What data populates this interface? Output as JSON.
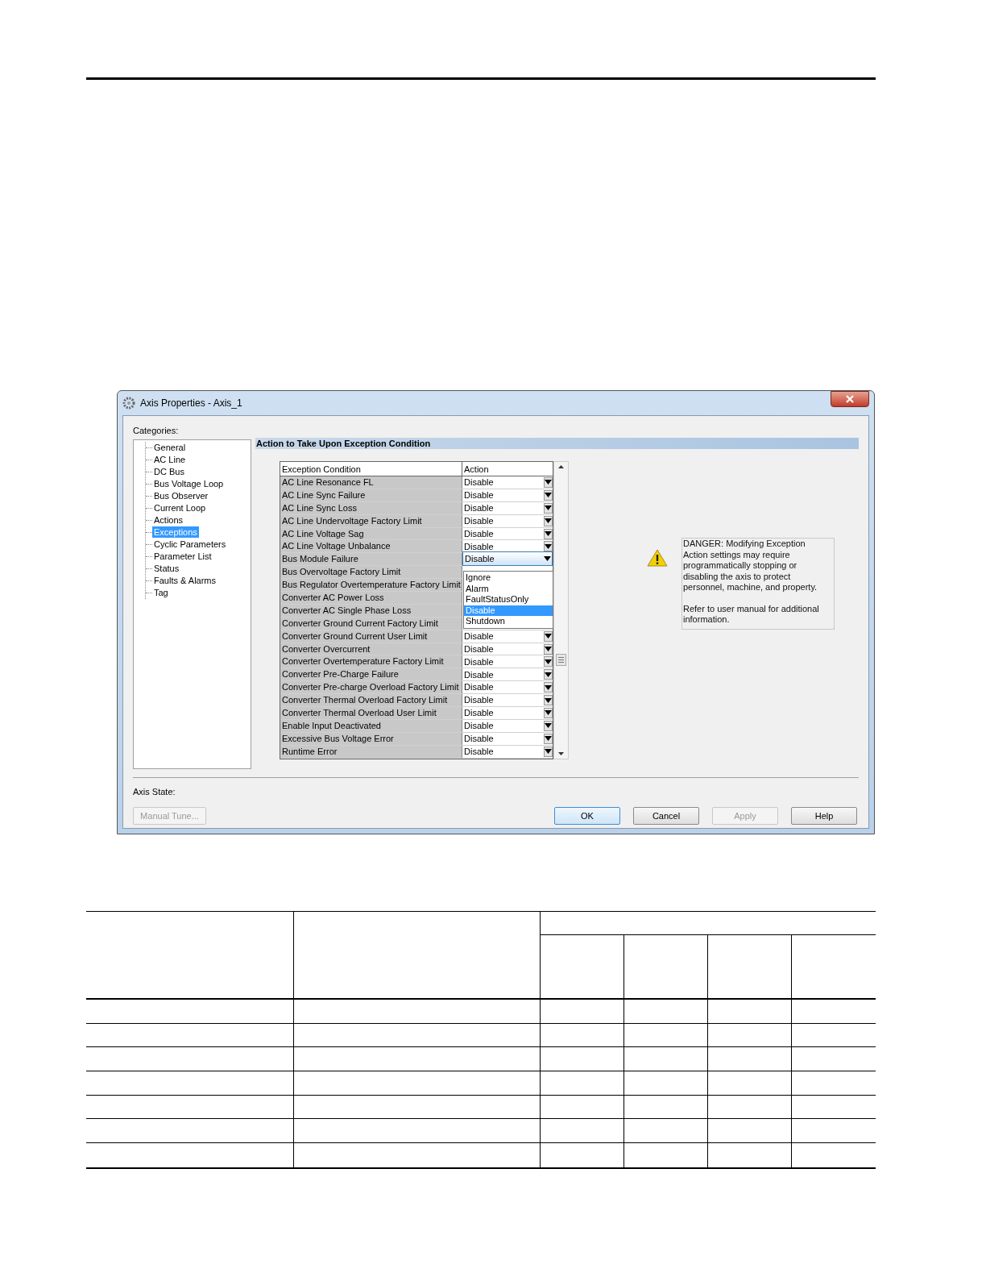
{
  "dialog": {
    "title": "Axis Properties - Axis_1",
    "categories_label": "Categories:",
    "categories": [
      {
        "label": "General",
        "selected": false
      },
      {
        "label": "AC Line",
        "selected": false
      },
      {
        "label": "DC Bus",
        "selected": false
      },
      {
        "label": "Bus Voltage Loop",
        "selected": false
      },
      {
        "label": "Bus Observer",
        "selected": false
      },
      {
        "label": "Current Loop",
        "selected": false
      },
      {
        "label": "Actions",
        "selected": false
      },
      {
        "label": "Exceptions",
        "selected": true
      },
      {
        "label": "Cyclic Parameters",
        "selected": false
      },
      {
        "label": "Parameter List",
        "selected": false
      },
      {
        "label": "Status",
        "selected": false
      },
      {
        "label": "Faults & Alarms",
        "selected": false
      },
      {
        "label": "Tag",
        "selected": false
      }
    ],
    "panel_title": "Action to Take Upon Exception Condition",
    "table": {
      "columns": [
        "Exception Condition",
        "Action"
      ],
      "rows": [
        {
          "condition": "AC Line Resonance FL",
          "action": "Disable",
          "kind": "select"
        },
        {
          "condition": "AC Line Sync Failure",
          "action": "Disable",
          "kind": "select"
        },
        {
          "condition": "AC Line Sync Loss",
          "action": "Disable",
          "kind": "select"
        },
        {
          "condition": "AC Line Undervoltage Factory Limit",
          "action": "Disable",
          "kind": "select"
        },
        {
          "condition": "AC Line Voltage Sag",
          "action": "Disable",
          "kind": "select"
        },
        {
          "condition": "AC Line Voltage Unbalance",
          "action": "Disable",
          "kind": "select"
        },
        {
          "condition": "Bus Module Failure",
          "action": "Disable",
          "kind": "open"
        },
        {
          "condition": "Bus Overvoltage Factory Limit",
          "kind": "covered"
        },
        {
          "condition": "Bus Regulator Overtemperature Factory Limit",
          "kind": "covered"
        },
        {
          "condition": "Converter AC Power Loss",
          "kind": "covered"
        },
        {
          "condition": "Converter AC Single Phase Loss",
          "kind": "covered"
        },
        {
          "condition": "Converter Ground Current Factory Limit",
          "kind": "covered"
        },
        {
          "condition": "Converter Ground Current User Limit",
          "action": "Disable",
          "kind": "select"
        },
        {
          "condition": "Converter Overcurrent",
          "action": "Disable",
          "kind": "select"
        },
        {
          "condition": "Converter Overtemperature Factory Limit",
          "action": "Disable",
          "kind": "select"
        },
        {
          "condition": "Converter Pre-Charge Failure",
          "action": "Disable",
          "kind": "select"
        },
        {
          "condition": "Converter Pre-charge Overload Factory Limit",
          "action": "Disable",
          "kind": "select"
        },
        {
          "condition": "Converter Thermal Overload Factory Limit",
          "action": "Disable",
          "kind": "select"
        },
        {
          "condition": "Converter Thermal Overload User Limit",
          "action": "Disable",
          "kind": "select"
        },
        {
          "condition": "Enable Input Deactivated",
          "action": "Disable",
          "kind": "select"
        },
        {
          "condition": "Excessive Bus Voltage Error",
          "action": "Disable",
          "kind": "select"
        },
        {
          "condition": "Runtime Error",
          "action": "Disable",
          "kind": "select"
        }
      ]
    },
    "dropdown": {
      "options": [
        {
          "label": "Ignore",
          "selected": false
        },
        {
          "label": "Alarm",
          "selected": false
        },
        {
          "label": "FaultStatusOnly",
          "selected": false
        },
        {
          "label": "Disable",
          "selected": true
        },
        {
          "label": "Shutdown",
          "selected": false
        }
      ]
    },
    "warning": {
      "paragraphs": [
        "DANGER: Modifying Exception Action settings may require programmatically stopping or disabling the axis to protect personnel, machine, and property.",
        "Refer to user manual for additional information."
      ]
    },
    "axis_state_label": "Axis State:",
    "buttons": [
      {
        "label": "Manual Tune...",
        "disabled": true,
        "default": false
      },
      {
        "label": "OK",
        "disabled": false,
        "default": true
      },
      {
        "label": "Cancel",
        "disabled": false,
        "default": false
      },
      {
        "label": "Apply",
        "disabled": true,
        "default": false
      },
      {
        "label": "Help",
        "disabled": false,
        "default": false
      }
    ]
  }
}
